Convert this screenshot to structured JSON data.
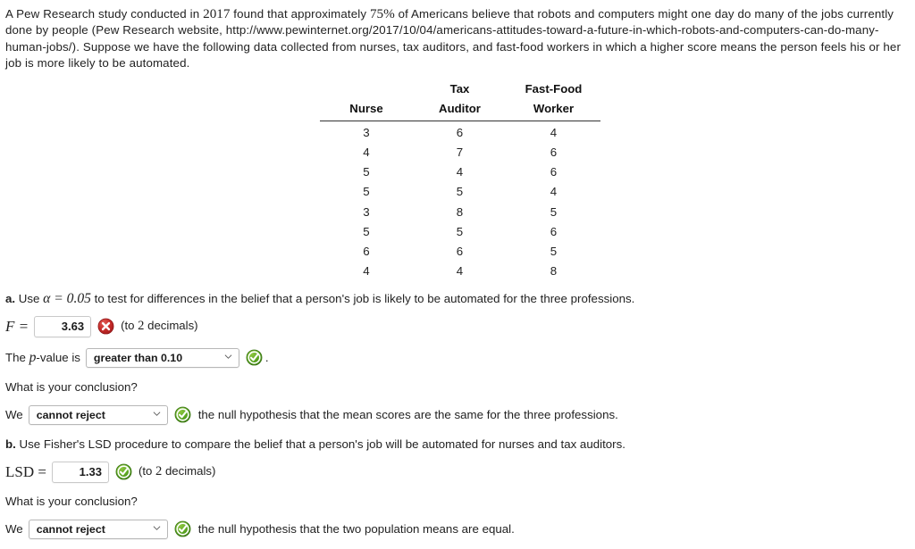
{
  "intro": {
    "part1": "A Pew Research study conducted in ",
    "year": "2017",
    "part2": " found that approximately ",
    "percent": "75%",
    "part3": " of Americans believe that robots and computers might one day do many of the jobs currently done by people (Pew Research website, http://www.pewinternet.org/2017/10/04/americans-attitudes-toward-a-future-in-which-robots-and-computers-can-do-many-human-jobs/). Suppose we have the following data collected from nurses, tax auditors, and fast-food workers in which a higher score means the person feels his or her job is more likely to be automated."
  },
  "table": {
    "headers": [
      {
        "line1": "",
        "line2": "Nurse"
      },
      {
        "line1": "Tax",
        "line2": "Auditor"
      },
      {
        "line1": "Fast-Food",
        "line2": "Worker"
      }
    ],
    "rows": [
      [
        "3",
        "6",
        "4"
      ],
      [
        "4",
        "7",
        "6"
      ],
      [
        "5",
        "4",
        "6"
      ],
      [
        "5",
        "5",
        "4"
      ],
      [
        "3",
        "8",
        "5"
      ],
      [
        "5",
        "5",
        "6"
      ],
      [
        "6",
        "6",
        "5"
      ],
      [
        "4",
        "4",
        "8"
      ]
    ]
  },
  "part_a": {
    "label": "a.",
    "text_before_alpha": " Use ",
    "alpha": "α = 0.05",
    "text_after_alpha": " to test for differences in the belief that a person's job is likely to be automated for the three professions.",
    "f_label": "F =",
    "f_value": "3.63",
    "f_status": "incorrect",
    "f_hint_before": "(to ",
    "f_hint_number": "2",
    "f_hint_after": " decimals)",
    "pvalue_label": "The p-value is",
    "pvalue_label_plain_before": "The ",
    "pvalue_label_italic": "p",
    "pvalue_label_plain_after": "-value is",
    "pvalue_selected": "greater than 0.10",
    "pvalue_status": "correct",
    "pvalue_period": ".",
    "conclusion_question": "What is your conclusion?",
    "conclusion_lead": "We",
    "conclusion_selected": "cannot reject",
    "conclusion_status": "correct",
    "conclusion_trail": "the null hypothesis that the mean scores are the same for the three professions."
  },
  "part_b": {
    "label": "b.",
    "text": " Use Fisher's LSD procedure to compare the belief that a person's job will be automated for nurses and tax auditors.",
    "lsd_label": "LSD =",
    "lsd_value": "1.33",
    "lsd_status": "correct",
    "lsd_hint_before": "(to ",
    "lsd_hint_number": "2",
    "lsd_hint_after": " decimals)",
    "conclusion_question": "What is your conclusion?",
    "conclusion_lead": "We",
    "conclusion_selected": "cannot reject",
    "conclusion_status": "correct",
    "conclusion_trail": "the null hypothesis that the two population means are equal."
  },
  "colors": {
    "correct_green": "#4e9a23",
    "incorrect_red": "#c0262a",
    "text": "#222222",
    "rule": "#333333"
  }
}
